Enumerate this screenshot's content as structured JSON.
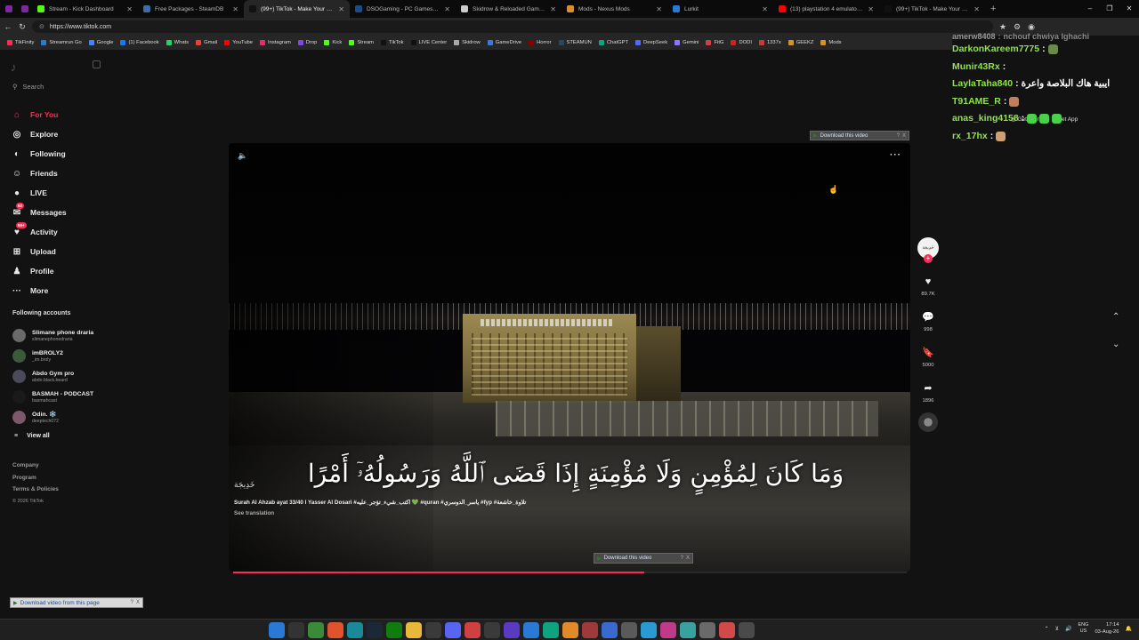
{
  "browser": {
    "tabs": [
      {
        "label": "",
        "color": "#7a2a9a",
        "mini": true
      },
      {
        "label": "",
        "color": "#7a2a9a",
        "mini": true
      },
      {
        "label": "Stream - Kick Dashboard",
        "color": "#53fc18"
      },
      {
        "label": "Free Packages - SteamDB",
        "color": "#3a6ea5"
      },
      {
        "label": "(99+) TikTok - Make Your Day",
        "color": "#111111",
        "active": true
      },
      {
        "label": "DSOGaming - PC Games News, S",
        "color": "#1e4a8a"
      },
      {
        "label": "Skidrow & Reloaded Games - Do",
        "color": "#cccccc"
      },
      {
        "label": "Mods - Nexus Mods",
        "color": "#d98f2b"
      },
      {
        "label": "Lurkit",
        "color": "#2a7ad5"
      },
      {
        "label": "(13) playstation 4 emulator on pc",
        "color": "#ff0000"
      },
      {
        "label": "(99+) TikTok - Make Your Day",
        "color": "#111111"
      }
    ],
    "new_tab": "+",
    "url": "https://www.tiktok.com",
    "window_controls": [
      "–",
      "❐",
      "✕"
    ],
    "bookmarks": [
      {
        "label": "TikFinity",
        "color": "#fe2c55"
      },
      {
        "label": "Streamrun Go",
        "color": "#2a7ad5"
      },
      {
        "label": "Google",
        "color": "#4285f4"
      },
      {
        "label": "(1) Facebook",
        "color": "#1877f2"
      },
      {
        "label": "Whats",
        "color": "#25d366"
      },
      {
        "label": "Gmail",
        "color": "#ea4335"
      },
      {
        "label": "YouTube",
        "color": "#ff0000"
      },
      {
        "label": "Instagram",
        "color": "#e1306c"
      },
      {
        "label": "Drop",
        "color": "#7a4ae0"
      },
      {
        "label": "Kick",
        "color": "#53fc18"
      },
      {
        "label": "Stream",
        "color": "#53fc18"
      },
      {
        "label": "TikTok",
        "color": "#111111"
      },
      {
        "label": "LIVE Center",
        "color": "#111111"
      },
      {
        "label": "Skidrow",
        "color": "#aaaaaa"
      },
      {
        "label": "GameDrive",
        "color": "#3a7ad5"
      },
      {
        "label": "Horror",
        "color": "#880000"
      },
      {
        "label": "STEAMUN",
        "color": "#2a475e"
      },
      {
        "label": "ChatGPT",
        "color": "#10a37f"
      },
      {
        "label": "DeepSeek",
        "color": "#4d6bfe"
      },
      {
        "label": "Gemini",
        "color": "#8e75ff"
      },
      {
        "label": "FitG",
        "color": "#d04040"
      },
      {
        "label": "DODI",
        "color": "#cc2222"
      },
      {
        "label": "1337x",
        "color": "#c43b3b"
      },
      {
        "label": "GEEKZ",
        "color": "#d98f2b"
      },
      {
        "label": "Mods",
        "color": "#d98f2b"
      }
    ]
  },
  "tiktok": {
    "search_placeholder": "Search",
    "menu": [
      {
        "label": "For You",
        "icon": "home-icon",
        "glyph": "⌂",
        "active": true
      },
      {
        "label": "Explore",
        "icon": "compass-icon",
        "glyph": "◎"
      },
      {
        "label": "Following",
        "icon": "following-icon",
        "glyph": "◐"
      },
      {
        "label": "Friends",
        "icon": "friends-icon",
        "glyph": "☺"
      },
      {
        "label": "LIVE",
        "icon": "live-icon",
        "glyph": "●"
      },
      {
        "label": "Messages",
        "icon": "messages-icon",
        "glyph": "✉",
        "badge": "92"
      },
      {
        "label": "Activity",
        "icon": "activity-icon",
        "glyph": "♥",
        "badge": "99+"
      },
      {
        "label": "Upload",
        "icon": "upload-icon",
        "glyph": "⊞"
      },
      {
        "label": "Profile",
        "icon": "profile-icon",
        "glyph": "♟"
      },
      {
        "label": "More",
        "icon": "more-icon",
        "glyph": "···"
      }
    ],
    "following_title": "Following accounts",
    "accounts": [
      {
        "name": "Slimane phone draria",
        "handle": "slimanephonedraria",
        "color": "#6a6a6a"
      },
      {
        "name": "imBROLY2",
        "handle": "_im.broly",
        "color": "#3a5a3a"
      },
      {
        "name": "Abdo Gym pro",
        "handle": "abdo.black.beard",
        "color": "#4a4a5a"
      },
      {
        "name": "BASMAH - PODCAST",
        "handle": "basmahcast",
        "color": "#1a1a1a"
      },
      {
        "name": "Odin. ❄️",
        "handle": "deeptech072",
        "color": "#7a5a6a"
      }
    ],
    "view_all": "View all",
    "footer": {
      "company": "Company",
      "program": "Program",
      "terms": "Terms & Policies",
      "copyright": "© 2026 TikTok"
    },
    "video": {
      "verse_text": "وَمَا كَانَ لِمُؤْمِنٍ وَلَا مُؤْمِنَةٍ إِذَا قَضَى ٱللَّهُ وَرَسُولُهُۥٓ أَمْرًا",
      "signature": "خَدِيجَة",
      "caption": "Surah Al Ahzab ayat 33/40 l Yasser Al Dosari #اكتب_شيء_تؤجر_عليه 💚 #quran #ياسر_الدوسري #fyp #تلاوة_خاشعة",
      "see_translation": "See translation",
      "progress_pct": 61
    },
    "actions": {
      "likes": "89.7K",
      "comments": "998",
      "saves": "5000",
      "shares": "1896"
    },
    "top_right": {
      "get_coins": "Get Coins",
      "get_app": "Get App"
    }
  },
  "download_overlays": {
    "top": "Download this video",
    "middle": "Download this video",
    "bottom": "Download video from this page",
    "help": "?",
    "close": "X"
  },
  "chat": [
    {
      "user": "amerw8408",
      "text": "nchouf chwiya lghachi",
      "color": "#9a9a9a",
      "faded": true
    },
    {
      "user": "DarkonKareem7775",
      "text": "",
      "color": "#8fe34a",
      "emotes": [
        "#6a8a4a"
      ]
    },
    {
      "user": "Munir43Rx",
      "text": "",
      "color": "#8fe34a",
      "emotes": []
    },
    {
      "user": "LaylaTaha840",
      "text": "ايبية هاك البلاصة واعرة",
      "color": "#8fe34a",
      "emotes": []
    },
    {
      "user": "T91AME_R",
      "text": "",
      "color": "#8fe34a",
      "emotes": [
        "#c08060"
      ]
    },
    {
      "user": "anas_king4158",
      "text": "",
      "color": "#8fe34a",
      "emotes": [
        "#4ad04a",
        "#4ad04a",
        "#4ad04a"
      ]
    },
    {
      "user": "rx_17hx",
      "text": "",
      "color": "#8fe34a",
      "emotes": [
        "#d0a070"
      ]
    }
  ],
  "taskbar": {
    "apps": [
      {
        "icon": "windows-start-icon",
        "color": "#2a7ad5"
      },
      {
        "icon": "search-icon",
        "color": "#333333"
      },
      {
        "icon": "chrome-icon",
        "color": "#3a8a3a"
      },
      {
        "icon": "brave-icon",
        "color": "#e0532d"
      },
      {
        "icon": "edge-icon",
        "color": "#1a8a9a"
      },
      {
        "icon": "steam-icon",
        "color": "#1b2838"
      },
      {
        "icon": "xbox-icon",
        "color": "#107c10"
      },
      {
        "icon": "files-icon",
        "color": "#e8b83a"
      },
      {
        "icon": "obs-icon",
        "color": "#3a3a3a"
      },
      {
        "icon": "discord-icon",
        "color": "#5865f2"
      },
      {
        "icon": "app-icon",
        "color": "#d04040"
      },
      {
        "icon": "app-icon",
        "color": "#3a3a3a"
      },
      {
        "icon": "app-icon",
        "color": "#5a3ac0"
      },
      {
        "icon": "app-icon",
        "color": "#2a7ad5"
      },
      {
        "icon": "app-icon",
        "color": "#10a37f"
      },
      {
        "icon": "app-icon",
        "color": "#e08a2a"
      },
      {
        "icon": "app-icon",
        "color": "#a03a3a"
      },
      {
        "icon": "app-icon",
        "color": "#3a6ad0"
      },
      {
        "icon": "app-icon",
        "color": "#5a5a5a"
      },
      {
        "icon": "app-icon",
        "color": "#2a9ad5"
      },
      {
        "icon": "app-icon",
        "color": "#c03a8a"
      },
      {
        "icon": "app-icon",
        "color": "#3aa0a0"
      },
      {
        "icon": "app-icon",
        "color": "#6a6a6a"
      },
      {
        "icon": "app-icon",
        "color": "#d04a4a"
      },
      {
        "icon": "settings-icon",
        "color": "#4a4a4a"
      }
    ],
    "lang_top": "ENG",
    "lang_bottom": "US",
    "time": "17:14",
    "date": "03-Aug-26"
  }
}
